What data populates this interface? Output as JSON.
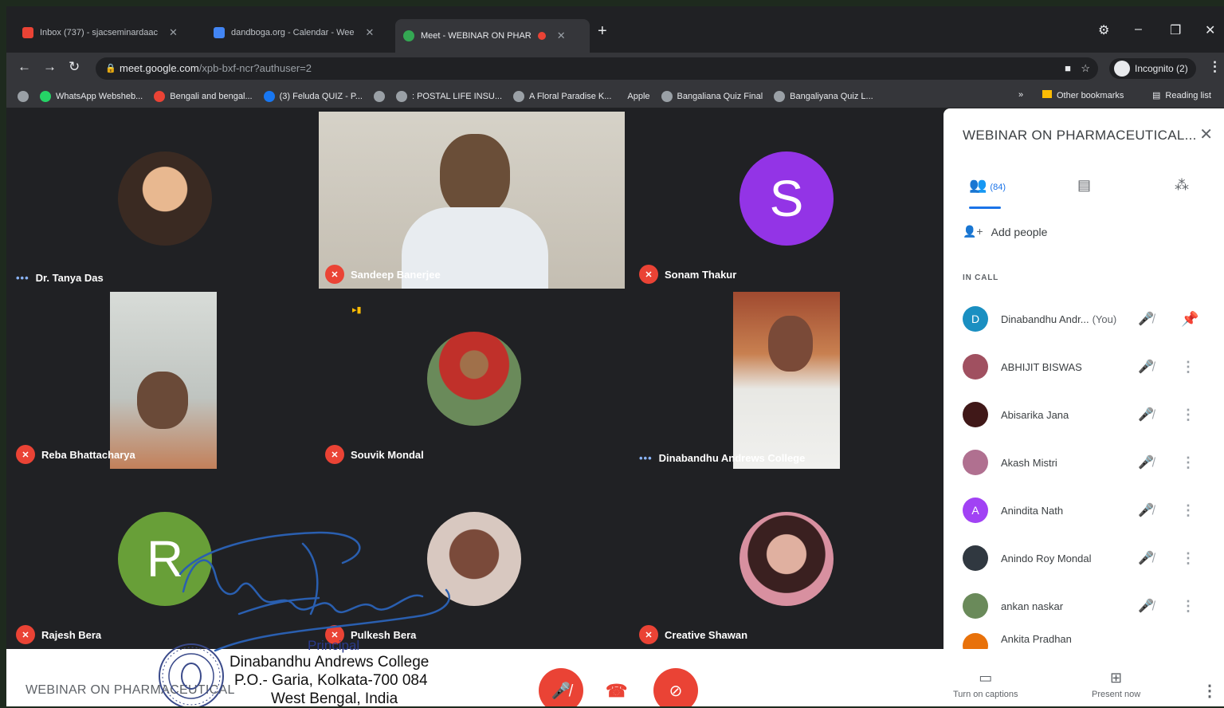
{
  "browser": {
    "tabs": [
      {
        "label": "Inbox (737) - sjacseminardaac",
        "favicon_color": "#ea4335"
      },
      {
        "label": "dandboga.org - Calendar - Wee",
        "favicon_color": "#4285f4"
      },
      {
        "label": "Meet - WEBINAR ON PHAR",
        "favicon_color": "#34a853"
      }
    ],
    "url_host": "meet.google.com",
    "url_path": "/xpb-bxf-ncr?authuser=2",
    "profile_label": "Incognito (2)"
  },
  "bookmarks": {
    "items": [
      "WhatsApp Websheb...",
      "Bengali and bengal...",
      "(3) Feluda QUIZ - P...",
      "",
      ": POSTAL LIFE INSU...",
      "A Floral Paradise K...",
      "Apple",
      "Bangaliana Quiz Final",
      "Bangaliyana Quiz L..."
    ],
    "other": "Other bookmarks",
    "reading": "Reading list"
  },
  "participants_grid": [
    {
      "name": "Dr. Tanya Das",
      "status": "speaking",
      "avatar_color": "#d8a27a"
    },
    {
      "name": "Sandeep Banerjee",
      "status": "muted",
      "avatar_color": "#5a4a3a"
    },
    {
      "name": "Sonam Thakur",
      "status": "muted",
      "avatar_letter": "S",
      "avatar_color": "#9334e6"
    },
    {
      "name": "Reba Bhattacharya",
      "status": "muted",
      "avatar_color": "#b07a50"
    },
    {
      "name": "Souvik Mondal",
      "status": "muted",
      "avatar_color": "#3a7fb8"
    },
    {
      "name": "Dinabandhu Andrews College",
      "status": "speaking",
      "avatar_color": "#c8785a"
    },
    {
      "name": "Rajesh Bera",
      "status": "muted",
      "avatar_letter": "R",
      "avatar_color": "#689f38"
    },
    {
      "name": "Pulkesh Bera",
      "status": "muted",
      "avatar_color": "#7a4a3a"
    },
    {
      "name": "Creative Shawan",
      "status": "muted",
      "avatar_color": "#e0a0a8"
    }
  ],
  "panel": {
    "title": "WEBINAR ON PHARMACEUTICAL...",
    "people_count": "(84)",
    "add_people": "Add people",
    "section": "IN CALL",
    "you_label": "(You)",
    "people": [
      {
        "name": "Dinabandhu Andr...",
        "letter": "D",
        "color": "#1a8fc1",
        "you": true
      },
      {
        "name": "ABHIJIT BISWAS",
        "letter": "",
        "color": "#a05060"
      },
      {
        "name": "Abisarika Jana",
        "letter": "",
        "color": "#401818"
      },
      {
        "name": "Akash Mistri",
        "letter": "",
        "color": "#b07090"
      },
      {
        "name": "Anindita Nath",
        "letter": "A",
        "color": "#a142f4"
      },
      {
        "name": "Anindo Roy Mondal",
        "letter": "",
        "color": "#303840"
      },
      {
        "name": "ankan naskar",
        "letter": "",
        "color": "#6a8a5a"
      },
      {
        "name": "Ankita Pradhan",
        "letter": "",
        "color": "#e8710a"
      }
    ]
  },
  "bottombar": {
    "meeting_title": "WEBINAR ON PHARMACEUTICAL",
    "captions": "Turn on captions",
    "present": "Present now"
  },
  "stamp": {
    "role": "Principal",
    "line1": "Dinabandhu Andrews College",
    "line2": "P.O.- Garia, Kolkata-700 084",
    "line3": "West Bengal, India"
  }
}
